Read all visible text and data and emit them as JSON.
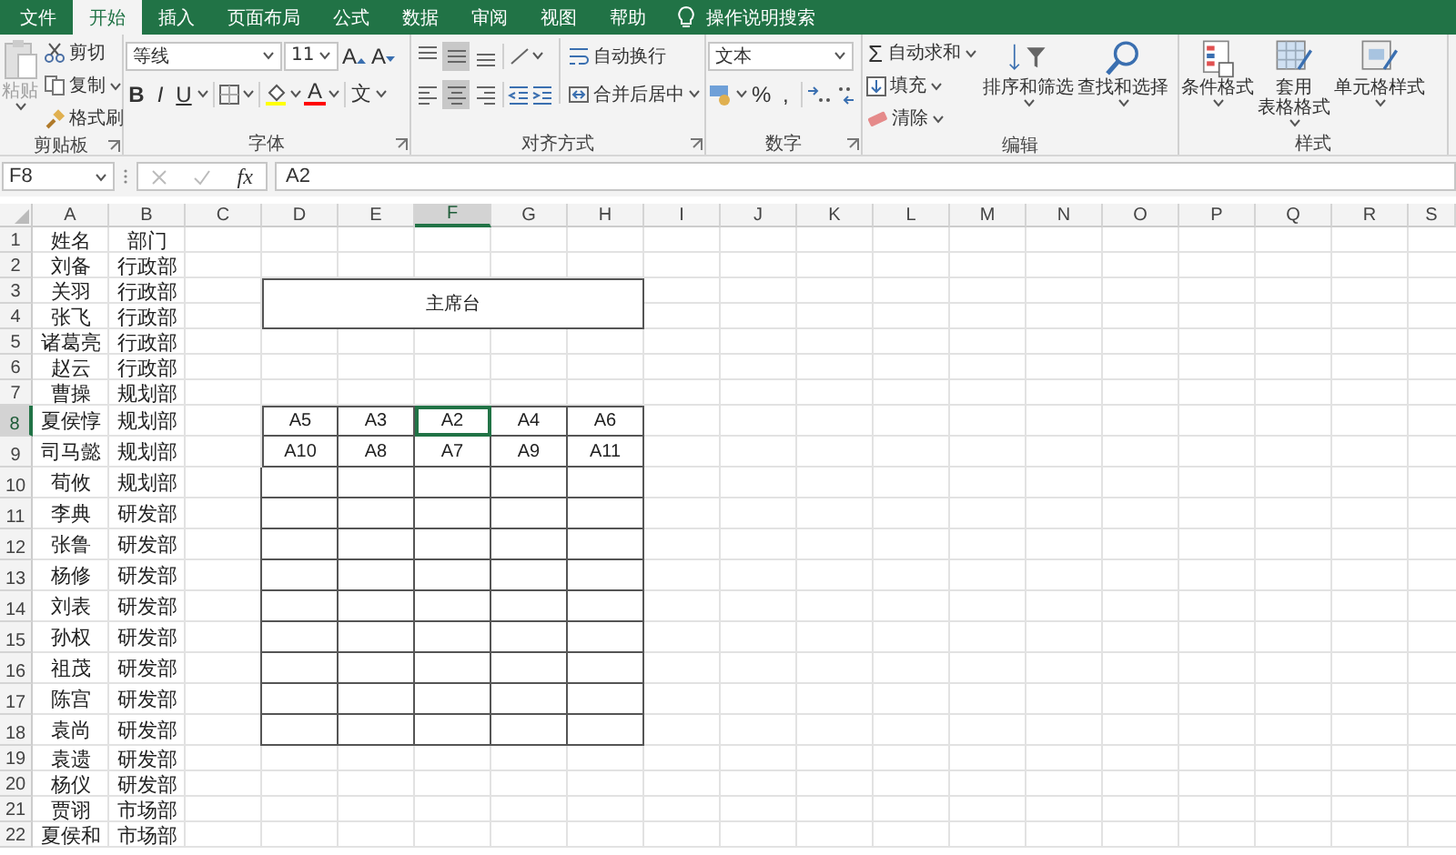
{
  "ribbon": {
    "tabs": [
      {
        "label": "文件",
        "selected": false
      },
      {
        "label": "开始",
        "selected": true
      },
      {
        "label": "插入",
        "selected": false
      },
      {
        "label": "页面布局",
        "selected": false
      },
      {
        "label": "公式",
        "selected": false
      },
      {
        "label": "数据",
        "selected": false
      },
      {
        "label": "审阅",
        "selected": false
      },
      {
        "label": "视图",
        "selected": false
      },
      {
        "label": "帮助",
        "selected": false
      }
    ],
    "search_hint": "操作说明搜索",
    "groups": [
      {
        "kind": "clipboard",
        "label": "剪贴板",
        "has_launcher": true,
        "paste": {
          "label": "粘贴",
          "disabled": true
        },
        "commands": [
          "剪切",
          "复制",
          "格式刷"
        ]
      },
      {
        "kind": "font",
        "label": "字体",
        "has_launcher": true,
        "font_name": "等线",
        "font_size": "11",
        "size_buttons": [
          "A",
          "A"
        ],
        "styles": [
          "B",
          "I",
          "U"
        ],
        "font_color_letter": "A",
        "phonetic": "文"
      },
      {
        "kind": "alignment",
        "label": "对齐方式",
        "has_launcher": true,
        "vertical_align": [
          {
            "selected": false
          },
          {
            "selected": true
          },
          {
            "selected": false
          }
        ],
        "horizontal_align": [
          {
            "selected": false
          },
          {
            "selected": true
          },
          {
            "selected": false
          }
        ],
        "commands": [
          "自动换行",
          "合并后居中"
        ]
      },
      {
        "kind": "number",
        "label": "数字",
        "has_launcher": true,
        "format": "文本",
        "symbols": [
          "%",
          ","
        ]
      },
      {
        "kind": "editing",
        "label": "编辑",
        "has_launcher": false,
        "sum_symbol": "Σ",
        "commands": [
          "自动求和",
          "填充",
          "清除"
        ],
        "large": [
          "排序和筛选",
          "查找和选择"
        ]
      },
      {
        "kind": "styles",
        "label": "样式",
        "has_launcher": false,
        "large": [
          [
            "条件格式"
          ],
          [
            "套用",
            "表格格式"
          ],
          [
            "单元格样式"
          ]
        ]
      }
    ]
  },
  "formula_bar": {
    "name_box": "F8",
    "function_label": "fx",
    "formula": "A2"
  },
  "sheet": {
    "columns": [
      {
        "label": "A",
        "selected": false
      },
      {
        "label": "B",
        "selected": false
      },
      {
        "label": "C",
        "selected": false
      },
      {
        "label": "D",
        "selected": false
      },
      {
        "label": "E",
        "selected": false
      },
      {
        "label": "F",
        "selected": true
      },
      {
        "label": "G",
        "selected": false
      },
      {
        "label": "H",
        "selected": false
      },
      {
        "label": "I",
        "selected": false
      },
      {
        "label": "J",
        "selected": false
      },
      {
        "label": "K",
        "selected": false
      },
      {
        "label": "L",
        "selected": false
      },
      {
        "label": "M",
        "selected": false
      },
      {
        "label": "N",
        "selected": false
      },
      {
        "label": "O",
        "selected": false
      },
      {
        "label": "P",
        "selected": false
      },
      {
        "label": "Q",
        "selected": false
      },
      {
        "label": "R",
        "selected": false
      },
      {
        "label": "S",
        "selected": false
      }
    ],
    "rows": [
      {
        "number": "1",
        "selected": false,
        "cells": [
          "姓名",
          "部门"
        ]
      },
      {
        "number": "2",
        "selected": false,
        "cells": [
          "刘备",
          "行政部"
        ]
      },
      {
        "number": "3",
        "selected": false,
        "cells": [
          "关羽",
          "行政部"
        ]
      },
      {
        "number": "4",
        "selected": false,
        "cells": [
          "张飞",
          "行政部"
        ]
      },
      {
        "number": "5",
        "selected": false,
        "cells": [
          "诸葛亮",
          "行政部"
        ]
      },
      {
        "number": "6",
        "selected": false,
        "cells": [
          "赵云",
          "行政部"
        ]
      },
      {
        "number": "7",
        "selected": false,
        "cells": [
          "曹操",
          "规划部"
        ]
      },
      {
        "number": "8",
        "selected": true,
        "cells": [
          "夏侯惇",
          "规划部"
        ]
      },
      {
        "number": "9",
        "selected": false,
        "cells": [
          "司马懿",
          "规划部"
        ]
      },
      {
        "number": "10",
        "selected": false,
        "cells": [
          "荀攸",
          "规划部"
        ]
      },
      {
        "number": "11",
        "selected": false,
        "cells": [
          "李典",
          "研发部"
        ]
      },
      {
        "number": "12",
        "selected": false,
        "cells": [
          "张鲁",
          "研发部"
        ]
      },
      {
        "number": "13",
        "selected": false,
        "cells": [
          "杨修",
          "研发部"
        ]
      },
      {
        "number": "14",
        "selected": false,
        "cells": [
          "刘表",
          "研发部"
        ]
      },
      {
        "number": "15",
        "selected": false,
        "cells": [
          "孙权",
          "研发部"
        ]
      },
      {
        "number": "16",
        "selected": false,
        "cells": [
          "祖茂",
          "研发部"
        ]
      },
      {
        "number": "17",
        "selected": false,
        "cells": [
          "陈宫",
          "研发部"
        ]
      },
      {
        "number": "18",
        "selected": false,
        "cells": [
          "袁尚",
          "研发部"
        ]
      },
      {
        "number": "19",
        "selected": false,
        "cells": [
          "袁遗",
          "研发部"
        ]
      },
      {
        "number": "20",
        "selected": false,
        "cells": [
          "杨仪",
          "研发部"
        ]
      },
      {
        "number": "21",
        "selected": false,
        "cells": [
          "贾诩",
          "市场部"
        ]
      },
      {
        "number": "22",
        "selected": false,
        "cells": [
          "夏侯和",
          "市场部"
        ]
      }
    ],
    "seating_chart": {
      "title": "主席台",
      "rows": [
        {
          "seats": [
            {
              "label": "A5",
              "selected": false
            },
            {
              "label": "A3",
              "selected": false
            },
            {
              "label": "A2",
              "selected": true
            },
            {
              "label": "A4",
              "selected": false
            },
            {
              "label": "A6",
              "selected": false
            }
          ]
        },
        {
          "seats": [
            {
              "label": "A10",
              "selected": false
            },
            {
              "label": "A8",
              "selected": false
            },
            {
              "label": "A7",
              "selected": false
            },
            {
              "label": "A9",
              "selected": false
            },
            {
              "label": "A11",
              "selected": false
            }
          ]
        }
      ]
    }
  }
}
